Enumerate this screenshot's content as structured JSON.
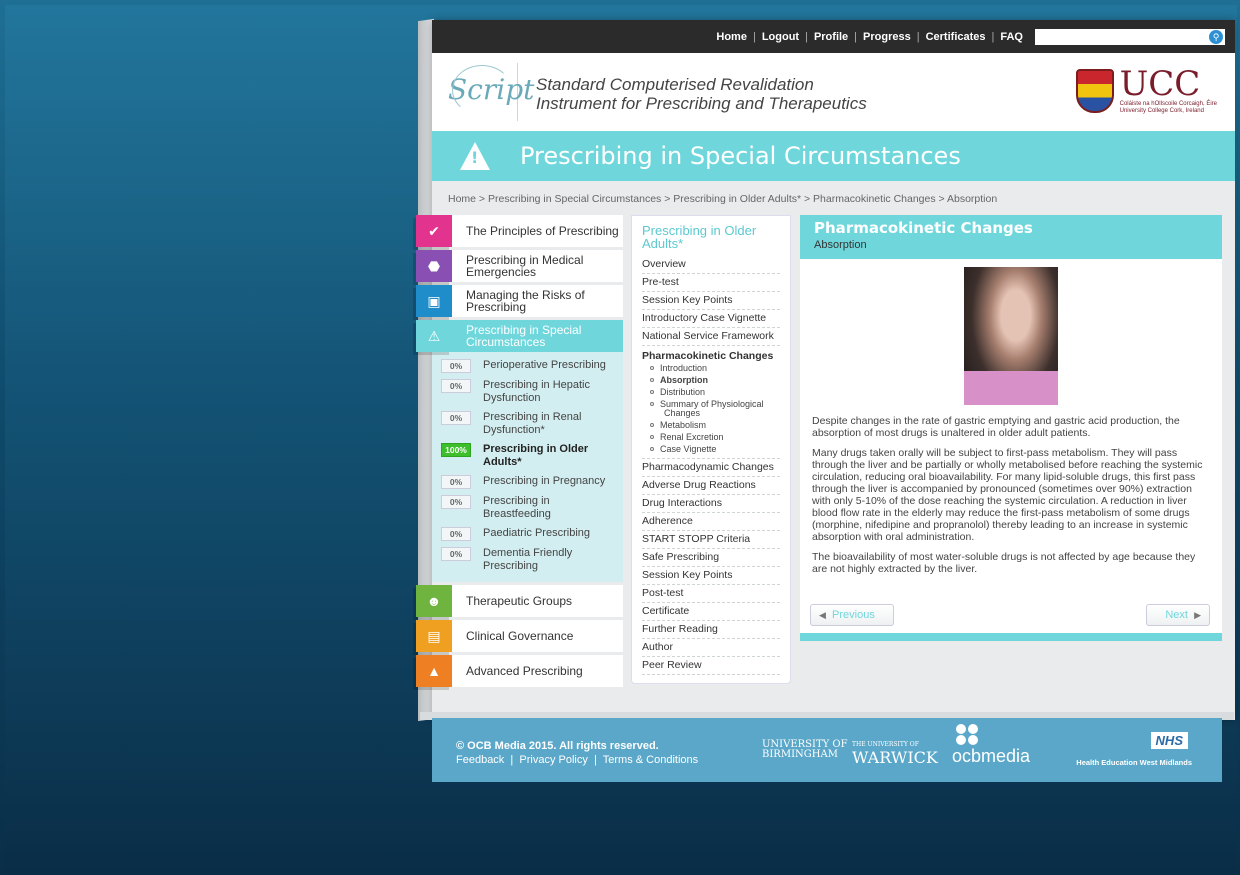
{
  "topnav": {
    "items": [
      "Home",
      "Logout",
      "Profile",
      "Progress",
      "Certificates",
      "FAQ"
    ],
    "search_placeholder": ""
  },
  "header": {
    "logo_text": "Script",
    "title_line1": "Standard Computerised Revalidation",
    "title_line2": "Instrument for Prescribing and Therapeutics",
    "ucc_name": "UCC",
    "ucc_sub1": "Coláiste na hOllscoile Corcaigh, Éire",
    "ucc_sub2": "University College Cork, Ireland"
  },
  "banner": {
    "title": "Prescribing in Special Circumstances"
  },
  "breadcrumb": "Home > Prescribing in Special Circumstances > Prescribing in Older Adults* > Pharmacokinetic Changes > Absorption",
  "leftnav": {
    "items": [
      {
        "label": "The Principles of Prescribing",
        "color": "#e2338f",
        "icon": "pill-icon"
      },
      {
        "label": "Prescribing in Medical Emergencies",
        "color": "#8a4fb2",
        "icon": "emergency-icon"
      },
      {
        "label": "Managing the Risks of Prescribing",
        "color": "#1f8dc9",
        "icon": "camera-icon"
      },
      {
        "label": "Prescribing in Special Circumstances",
        "color": "#6fd7dc",
        "icon": "warning-icon",
        "active": true
      }
    ],
    "subitems": [
      {
        "pct": "0%",
        "label": "Perioperative Prescribing"
      },
      {
        "pct": "0%",
        "label": "Prescribing in Hepatic Dysfunction"
      },
      {
        "pct": "0%",
        "label": "Prescribing in Renal Dysfunction*"
      },
      {
        "pct": "100%",
        "label": "Prescribing in Older Adults*",
        "done": true
      },
      {
        "pct": "0%",
        "label": "Prescribing in Pregnancy"
      },
      {
        "pct": "0%",
        "label": "Prescribing in Breastfeeding"
      },
      {
        "pct": "0%",
        "label": "Paediatric Prescribing"
      },
      {
        "pct": "0%",
        "label": "Dementia Friendly Prescribing"
      }
    ],
    "bottom_items": [
      {
        "label": "Therapeutic Groups",
        "color": "#6eb43f",
        "icon": "people-icon"
      },
      {
        "label": "Clinical Governance",
        "color": "#f0a020",
        "icon": "document-icon"
      },
      {
        "label": "Advanced Prescribing",
        "color": "#ee7f22",
        "icon": "graduation-cap-icon"
      }
    ]
  },
  "midcol": {
    "title": "Prescribing in Older Adults*",
    "links_top": [
      "Overview",
      "Pre-test",
      "Session Key Points",
      "Introductory Case Vignette",
      "National Service Framework"
    ],
    "section": "Pharmacokinetic Changes",
    "subs": [
      {
        "label": "Introduction"
      },
      {
        "label": "Absorption",
        "bold": true
      },
      {
        "label": "Distribution"
      },
      {
        "label": "Summary of Physiological Changes"
      },
      {
        "label": "Metabolism"
      },
      {
        "label": "Renal Excretion"
      },
      {
        "label": "Case Vignette"
      }
    ],
    "links_bottom": [
      "Pharmacodynamic Changes",
      "Adverse Drug Reactions",
      "Drug Interactions",
      "Adherence",
      "START STOPP Criteria",
      "Safe Prescribing",
      "Session Key Points",
      "Post-test",
      "Certificate",
      "Further Reading",
      "Author",
      "Peer Review"
    ]
  },
  "card": {
    "title": "Pharmacokinetic Changes",
    "subtitle": "Absorption",
    "paragraphs": [
      "Despite changes in the rate of gastric emptying and gastric acid production, the absorption of most drugs is unaltered in older adult patients.",
      "Many drugs taken orally will be subject to first-pass metabolism.  They will pass through the liver and be partially or wholly metabolised before reaching the systemic circulation, reducing oral bioavailability.  For many lipid-soluble drugs, this first pass through the liver is accompanied by pronounced (sometimes over 90%) extraction with only 5-10% of the dose reaching the systemic circulation.  A reduction in liver blood flow rate in the elderly may reduce the first-pass metabolism of some drugs (morphine, nifedipine and propranolol) thereby leading to an increase in systemic absorption with oral administration.",
      "The bioavailability of most water-soluble drugs is not affected by age because they are not highly extracted by the liver."
    ],
    "prev_label": "Previous",
    "next_label": "Next"
  },
  "footer": {
    "copyright": "© OCB Media 2015. All rights reserved.",
    "links": [
      "Feedback",
      "Privacy Policy",
      "Terms & Conditions"
    ],
    "birmingham_line1": "UNIVERSITY OF",
    "birmingham_line2": "BIRMINGHAM",
    "warwick_top": "THE UNIVERSITY OF",
    "warwick": "WARWICK",
    "ocb": "ocbmedia",
    "nhs": "NHS",
    "hewm": "Health Education West Midlands"
  }
}
